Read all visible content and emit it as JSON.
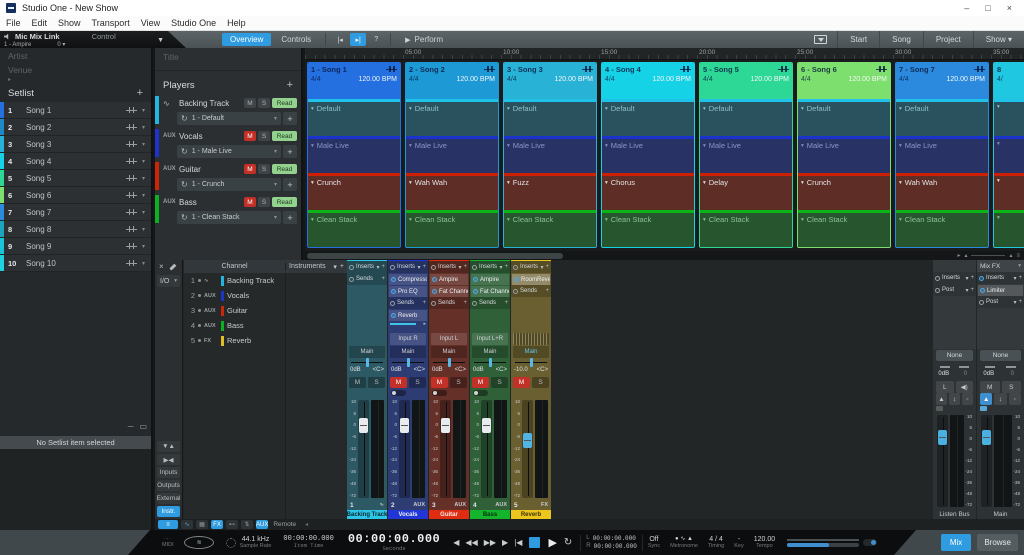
{
  "window": {
    "title": "Studio One - New Show",
    "minimize": "–",
    "maximize": "□",
    "close": "×"
  },
  "menu": {
    "items": [
      "File",
      "Edit",
      "Show",
      "Transport",
      "View",
      "Studio One",
      "Help"
    ]
  },
  "toolbar": {
    "device": {
      "name": "Mic Mix Link",
      "mode": "Control",
      "preset": "1 - Ampire",
      "value": "0"
    },
    "tabs": [
      {
        "label": "Overview",
        "active": true
      },
      {
        "label": "Controls",
        "active": false
      }
    ],
    "help_label": "?",
    "perform_label": "Perform",
    "pages": [
      "Start",
      "Song",
      "Project",
      "Show"
    ]
  },
  "sidebar": {
    "artist_placeholder": "Artist",
    "venue_placeholder": "Venue",
    "setlist_label": "Setlist",
    "add_label": "+",
    "songs": [
      {
        "num": "1",
        "name": "Song 1",
        "color": "#2470e0"
      },
      {
        "num": "2",
        "name": "Song 2",
        "color": "#1d89c8"
      },
      {
        "num": "3",
        "name": "Song 3",
        "color": "#28b2d6"
      },
      {
        "num": "4",
        "name": "Song 4",
        "color": "#16d2e6"
      },
      {
        "num": "5",
        "name": "Song 5",
        "color": "#2dd896"
      },
      {
        "num": "6",
        "name": "Song 6",
        "color": "#7de06e"
      },
      {
        "num": "7",
        "name": "Song 7",
        "color": "#2b8ade"
      },
      {
        "num": "8",
        "name": "Song 8",
        "color": "#1ba4bc"
      },
      {
        "num": "9",
        "name": "Song 9",
        "color": "#19c4d8"
      },
      {
        "num": "10",
        "name": "Song 10",
        "color": "#1fd0de"
      }
    ],
    "empty_message": "No Setlist item selected"
  },
  "players": {
    "title_placeholder": "Title",
    "header": "Players",
    "add_label": "+",
    "mute_label": "M",
    "solo_label": "S",
    "items": [
      {
        "badge": "wave",
        "name": "Backing Track",
        "color": "#24b4e0",
        "mute_active": false,
        "auto": "Read",
        "patch": "1 - Default"
      },
      {
        "badge": "AUX",
        "name": "Vocals",
        "color": "#1c34cc",
        "mute_active": true,
        "auto": "Read",
        "patch": "1 - Male Live"
      },
      {
        "badge": "AUX",
        "name": "Guitar",
        "color": "#cc2608",
        "mute_active": true,
        "auto": "Read",
        "patch": "1 - Crunch"
      },
      {
        "badge": "AUX",
        "name": "Bass",
        "color": "#0cb020",
        "mute_active": true,
        "auto": "Read",
        "patch": "1 - Clean Stack"
      }
    ]
  },
  "timeline": {
    "ruler": [
      "05:00",
      "10:00",
      "15:00",
      "20:00",
      "25:00",
      "30:00",
      "35:00"
    ],
    "lane_styles": {
      "backing": {
        "stripe": "#1fc2e8",
        "fill": "#2a525e",
        "text": "#8cc2cc"
      },
      "vocals": {
        "stripe": "#1c32cc",
        "fill": "#293264",
        "text": "#8c96cc"
      },
      "guitar": {
        "stripe": "#cc2000",
        "fill": "#5e2e26",
        "text": "#e4e4e4"
      },
      "bass": {
        "stripe": "#0ab416",
        "fill": "#27552e",
        "text": "#8cc296"
      }
    },
    "songs": [
      {
        "title": "1 - Song 1",
        "sig": "4/4",
        "bpm": "120.00 BPM",
        "color": "#2470e0",
        "patches": {
          "backing": "Default",
          "vocals": "Male Live",
          "guitar": "Crunch",
          "bass": "Clean Stack"
        }
      },
      {
        "title": "2 - Song 2",
        "sig": "4/4",
        "bpm": "120.00 BPM",
        "color": "#1d9ad6",
        "patches": {
          "backing": "Default",
          "vocals": "Male Live",
          "guitar": "Wah Wah",
          "bass": "Clean Stack"
        }
      },
      {
        "title": "3 - Song 3",
        "sig": "4/4",
        "bpm": "120.00 BPM",
        "color": "#28b2d6",
        "patches": {
          "backing": "Default",
          "vocals": "Male Live",
          "guitar": "Fuzz",
          "bass": "Clean Stack"
        }
      },
      {
        "title": "4 - Song 4",
        "sig": "4/4",
        "bpm": "120.00 BPM",
        "color": "#16d2e6",
        "patches": {
          "backing": "Default",
          "vocals": "Male Live",
          "guitar": "Chorus",
          "bass": "Clean Stack"
        }
      },
      {
        "title": "5 - Song 5",
        "sig": "4/4",
        "bpm": "120.00 BPM",
        "color": "#2dd896",
        "patches": {
          "backing": "Default",
          "vocals": "Male Live",
          "guitar": "Delay",
          "bass": "Clean Stack"
        }
      },
      {
        "title": "6 - Song 6",
        "sig": "4/4",
        "bpm": "120.00 BPM",
        "color": "#7de06e",
        "patches": {
          "backing": "Default",
          "vocals": "Male Live",
          "guitar": "Crunch",
          "bass": "Clean Stack"
        }
      },
      {
        "title": "7 - Song 7",
        "sig": "4/4",
        "bpm": "120.00 BPM",
        "color": "#2b8ade",
        "patches": {
          "backing": "Default",
          "vocals": "Male Live",
          "guitar": "Wah Wah",
          "bass": "Clean Stack"
        }
      },
      {
        "title": "8",
        "sig": "4/",
        "bpm": "",
        "color": "#1fc8e0",
        "patches": {
          "backing": "",
          "vocals": "",
          "guitar": "",
          "bass": ""
        }
      }
    ]
  },
  "mixer": {
    "io_label": "I/O",
    "channel_header": "Channel",
    "instruments_header": "Instruments",
    "nav": [
      {
        "label": "Inputs",
        "active": false
      },
      {
        "label": "Outputs",
        "active": false
      },
      {
        "label": "External",
        "active": false
      },
      {
        "label": "Instr.",
        "active": true
      }
    ],
    "remote_label": "Remote",
    "inserts_label": "Inserts",
    "sends_label": "Sends",
    "post_label": "Post",
    "mixfx_label": "Mix FX",
    "none_label": "None",
    "fader_scale": [
      "10",
      "6",
      "0",
      "-6",
      "-12",
      "-24",
      "-36",
      "-48",
      "-72"
    ],
    "channel_rows": [
      {
        "num": "1",
        "type": "wave",
        "name": "Backing Track",
        "color": "#24b4e0"
      },
      {
        "num": "2",
        "type": "AUX",
        "name": "Vocals",
        "color": "#1c34cc"
      },
      {
        "num": "3",
        "type": "AUX",
        "name": "Guitar",
        "color": "#cc2608"
      },
      {
        "num": "4",
        "type": "AUX",
        "name": "Bass",
        "color": "#0cb020"
      },
      {
        "num": "5",
        "type": "FX",
        "name": "Reverb",
        "color": "#e0c020"
      }
    ],
    "strips": [
      {
        "num": "1",
        "type": "wave",
        "name": "Backing Track",
        "tag": "#2ec6e8",
        "tag_text": "#06262e",
        "body": "#2d5965",
        "inserts": [],
        "sends": [],
        "input": null,
        "route": "Main",
        "route_active": false,
        "gain": "0dB",
        "pan": "<C>",
        "mute": false,
        "monitor": null,
        "fader_pos": 0.78,
        "fader_color": "#e8ecee"
      },
      {
        "num": "2",
        "type": "AUX",
        "name": "Vocals",
        "tag": "#2236d8",
        "tag_text": "#eef2f4",
        "body": "#2e3c74",
        "inserts": [
          "Compressor",
          "Pro EQ"
        ],
        "sends": [
          "Reverb"
        ],
        "input": "Input R",
        "route": "Main",
        "route_active": false,
        "gain": "0dB",
        "pan": "<C>",
        "mute": true,
        "monitor": true,
        "fader_pos": 0.78,
        "fader_color": "#e8ecee"
      },
      {
        "num": "3",
        "type": "AUX",
        "name": "Guitar",
        "tag": "#e02c10",
        "tag_text": "#fdeeea",
        "body": "#653028",
        "inserts": [
          "Ampire",
          "Fat Channel"
        ],
        "sends": [],
        "input": "Input L",
        "route": "Main",
        "route_active": false,
        "gain": "0dB",
        "pan": "<C>",
        "mute": true,
        "monitor": true,
        "fader_pos": 0.78,
        "fader_color": "#e8ecee"
      },
      {
        "num": "4",
        "type": "AUX",
        "name": "Bass",
        "tag": "#14b42c",
        "tag_text": "#04300e",
        "body": "#2f6038",
        "inserts": [
          "Ampire",
          "Fat Channel"
        ],
        "sends": [],
        "input": "Input L+R",
        "route": "Main",
        "route_active": false,
        "gain": "0dB",
        "pan": "<C>",
        "mute": true,
        "monitor": true,
        "fader_pos": 0.78,
        "fader_color": "#e8ecee"
      },
      {
        "num": "5",
        "type": "FX",
        "name": "Reverb",
        "tag": "#ecc61c",
        "tag_text": "#3a3206",
        "body": "#6a5f30",
        "inserts": [
          "RoomReverb"
        ],
        "sends": [],
        "input": "dotted",
        "route": "Main",
        "route_active": true,
        "gain": "-10.0",
        "pan": "<C>",
        "mute": true,
        "monitor": null,
        "fader_pos": 0.6,
        "fader_color": "#52b4e4"
      }
    ],
    "buses": [
      {
        "name": "Listen Bus",
        "mixfx": null,
        "inserts": [],
        "b1": "L",
        "b2": "◀)",
        "gain": "0dB",
        "gain2": "0",
        "fader_pos": 0.8,
        "width": 43,
        "main_icon": false
      },
      {
        "name": "Main",
        "mixfx": "Mix FX",
        "inserts": [
          "Limiter"
        ],
        "b1": "M",
        "b2": "S",
        "gain": "0dB",
        "gain2": "0",
        "fader_pos": 0.8,
        "width": 47,
        "main_icon": true
      }
    ]
  },
  "transport": {
    "midi_label": "MIDI",
    "sample_rate": "44.1 kHz",
    "sample_rate_label": "Sample Rate",
    "item_time": "00:00:00.000",
    "item_time_label": "Item Time",
    "time": "00:00:00.000",
    "time_label": "Seconds",
    "loop_l_prefix": "L",
    "loop_l": "00:00:00.000",
    "loop_r_prefix": "R",
    "loop_r": "00:00:00.000",
    "sync_value": "Off",
    "sync_label": "Sync",
    "metronome_label": "Metronome",
    "timing_value": "4 / 4",
    "timing_label": "Timing",
    "key_value": "-",
    "key_label": "Key",
    "tempo_value": "120.00",
    "tempo_label": "Tempo",
    "mix_label": "Mix",
    "browse_label": "Browse",
    "logo_text": "≋"
  }
}
